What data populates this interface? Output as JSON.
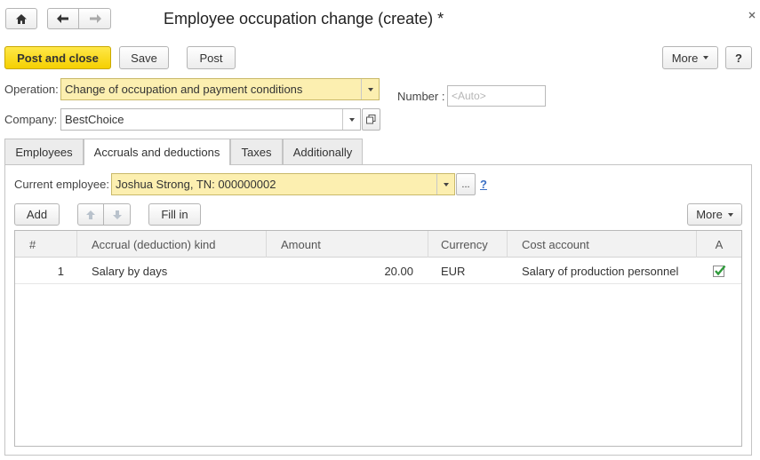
{
  "window": {
    "title": "Employee occupation change (create) *"
  },
  "toolbar": {
    "post_and_close": "Post and close",
    "save": "Save",
    "post": "Post",
    "more": "More",
    "help": "?"
  },
  "form": {
    "operation_label": "Operation:",
    "operation_value": "Change of occupation and payment conditions",
    "number_label": "Number :",
    "number_placeholder": "<Auto>",
    "company_label": "Company:",
    "company_value": "BestChoice"
  },
  "tabs": [
    {
      "label": "Employees"
    },
    {
      "label": "Accruals and deductions",
      "active": true
    },
    {
      "label": "Taxes"
    },
    {
      "label": "Additionally"
    }
  ],
  "accruals": {
    "current_employee_label": "Current employee:",
    "current_employee_value": "Joshua Strong, TN: 000000002",
    "ellipsis": "...",
    "help": "?",
    "add": "Add",
    "fill_in": "Fill in",
    "more": "More",
    "columns": [
      "#",
      "Accrual (deduction) kind",
      "Amount",
      "Currency",
      "Cost account",
      "A"
    ],
    "rows": [
      {
        "num": "1",
        "kind": "Salary by days",
        "amount": "20.00",
        "currency": "EUR",
        "cost_account": "Salary of production personnel",
        "active": true
      }
    ]
  },
  "colors": {
    "accent_yellow": "#f5d000",
    "field_yellow": "#fcefb0",
    "check_green": "#2e9a3a",
    "link_blue": "#3a6fc4"
  }
}
